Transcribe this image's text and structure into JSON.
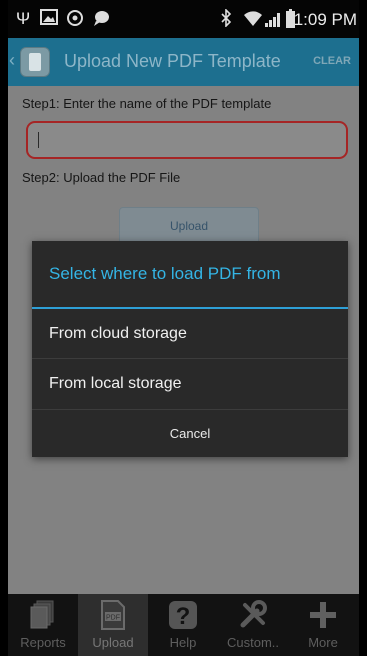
{
  "status_bar": {
    "time": "1:09 PM",
    "left_icons": [
      "usb-icon",
      "image-icon",
      "data-sync-icon",
      "chat-icon"
    ],
    "right_icons": [
      "bluetooth-icon",
      "wifi-icon",
      "signal-icon",
      "battery-icon"
    ]
  },
  "action_bar": {
    "title": "Upload New PDF Template",
    "clear_label": "CLEAR"
  },
  "form": {
    "step1_label": "Step1: Enter the name of the PDF template",
    "template_name_value": "",
    "step2_label": "Step2: Upload the PDF File",
    "upload_label": "Upload"
  },
  "dialog": {
    "title": "Select where to load PDF from",
    "options": [
      {
        "label": "From cloud storage"
      },
      {
        "label": "From local storage"
      }
    ],
    "cancel_label": "Cancel"
  },
  "bottom_nav": {
    "tabs": [
      {
        "label": "Reports",
        "icon": "reports-icon",
        "active": false
      },
      {
        "label": "Upload",
        "icon": "pdf-upload-icon",
        "active": true
      },
      {
        "label": "Help",
        "icon": "help-icon",
        "active": false
      },
      {
        "label": "Custom..",
        "icon": "tools-icon",
        "active": false
      },
      {
        "label": "More",
        "icon": "plus-icon",
        "active": false
      }
    ]
  },
  "colors": {
    "action_bar": "#1d6f8f",
    "dialog_accent": "#34b5e5",
    "input_border": "#a52525"
  }
}
